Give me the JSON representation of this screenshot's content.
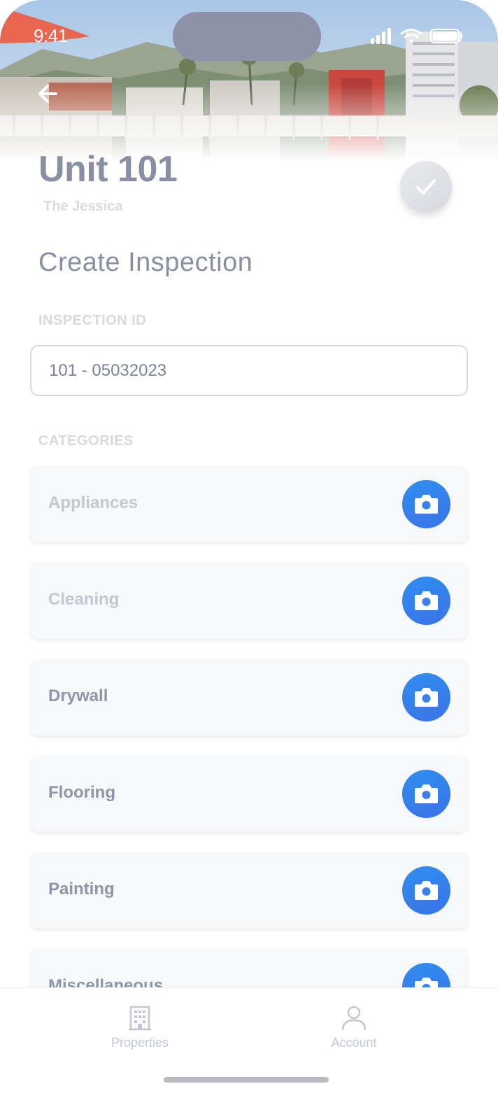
{
  "status_bar": {
    "time": "9:41"
  },
  "header": {
    "title": "Unit 101",
    "subtitle": "The Jessica"
  },
  "main": {
    "heading": "Create Inspection",
    "inspection_id": {
      "label": "INSPECTION ID",
      "value": "101 - 05032023"
    },
    "categories_label": "CATEGORIES",
    "categories": [
      {
        "label": "Appliances"
      },
      {
        "label": "Cleaning"
      },
      {
        "label": "Drywall"
      },
      {
        "label": "Flooring"
      },
      {
        "label": "Painting"
      },
      {
        "label": "Miscellaneous"
      }
    ]
  },
  "tabbar": {
    "items": [
      {
        "label": "Properties",
        "icon": "building-icon"
      },
      {
        "label": "Account",
        "icon": "person-icon"
      }
    ]
  },
  "colors": {
    "accent": "#3a7fec",
    "title": "#8a8ea3",
    "muted_label": "#d6d8e2"
  }
}
